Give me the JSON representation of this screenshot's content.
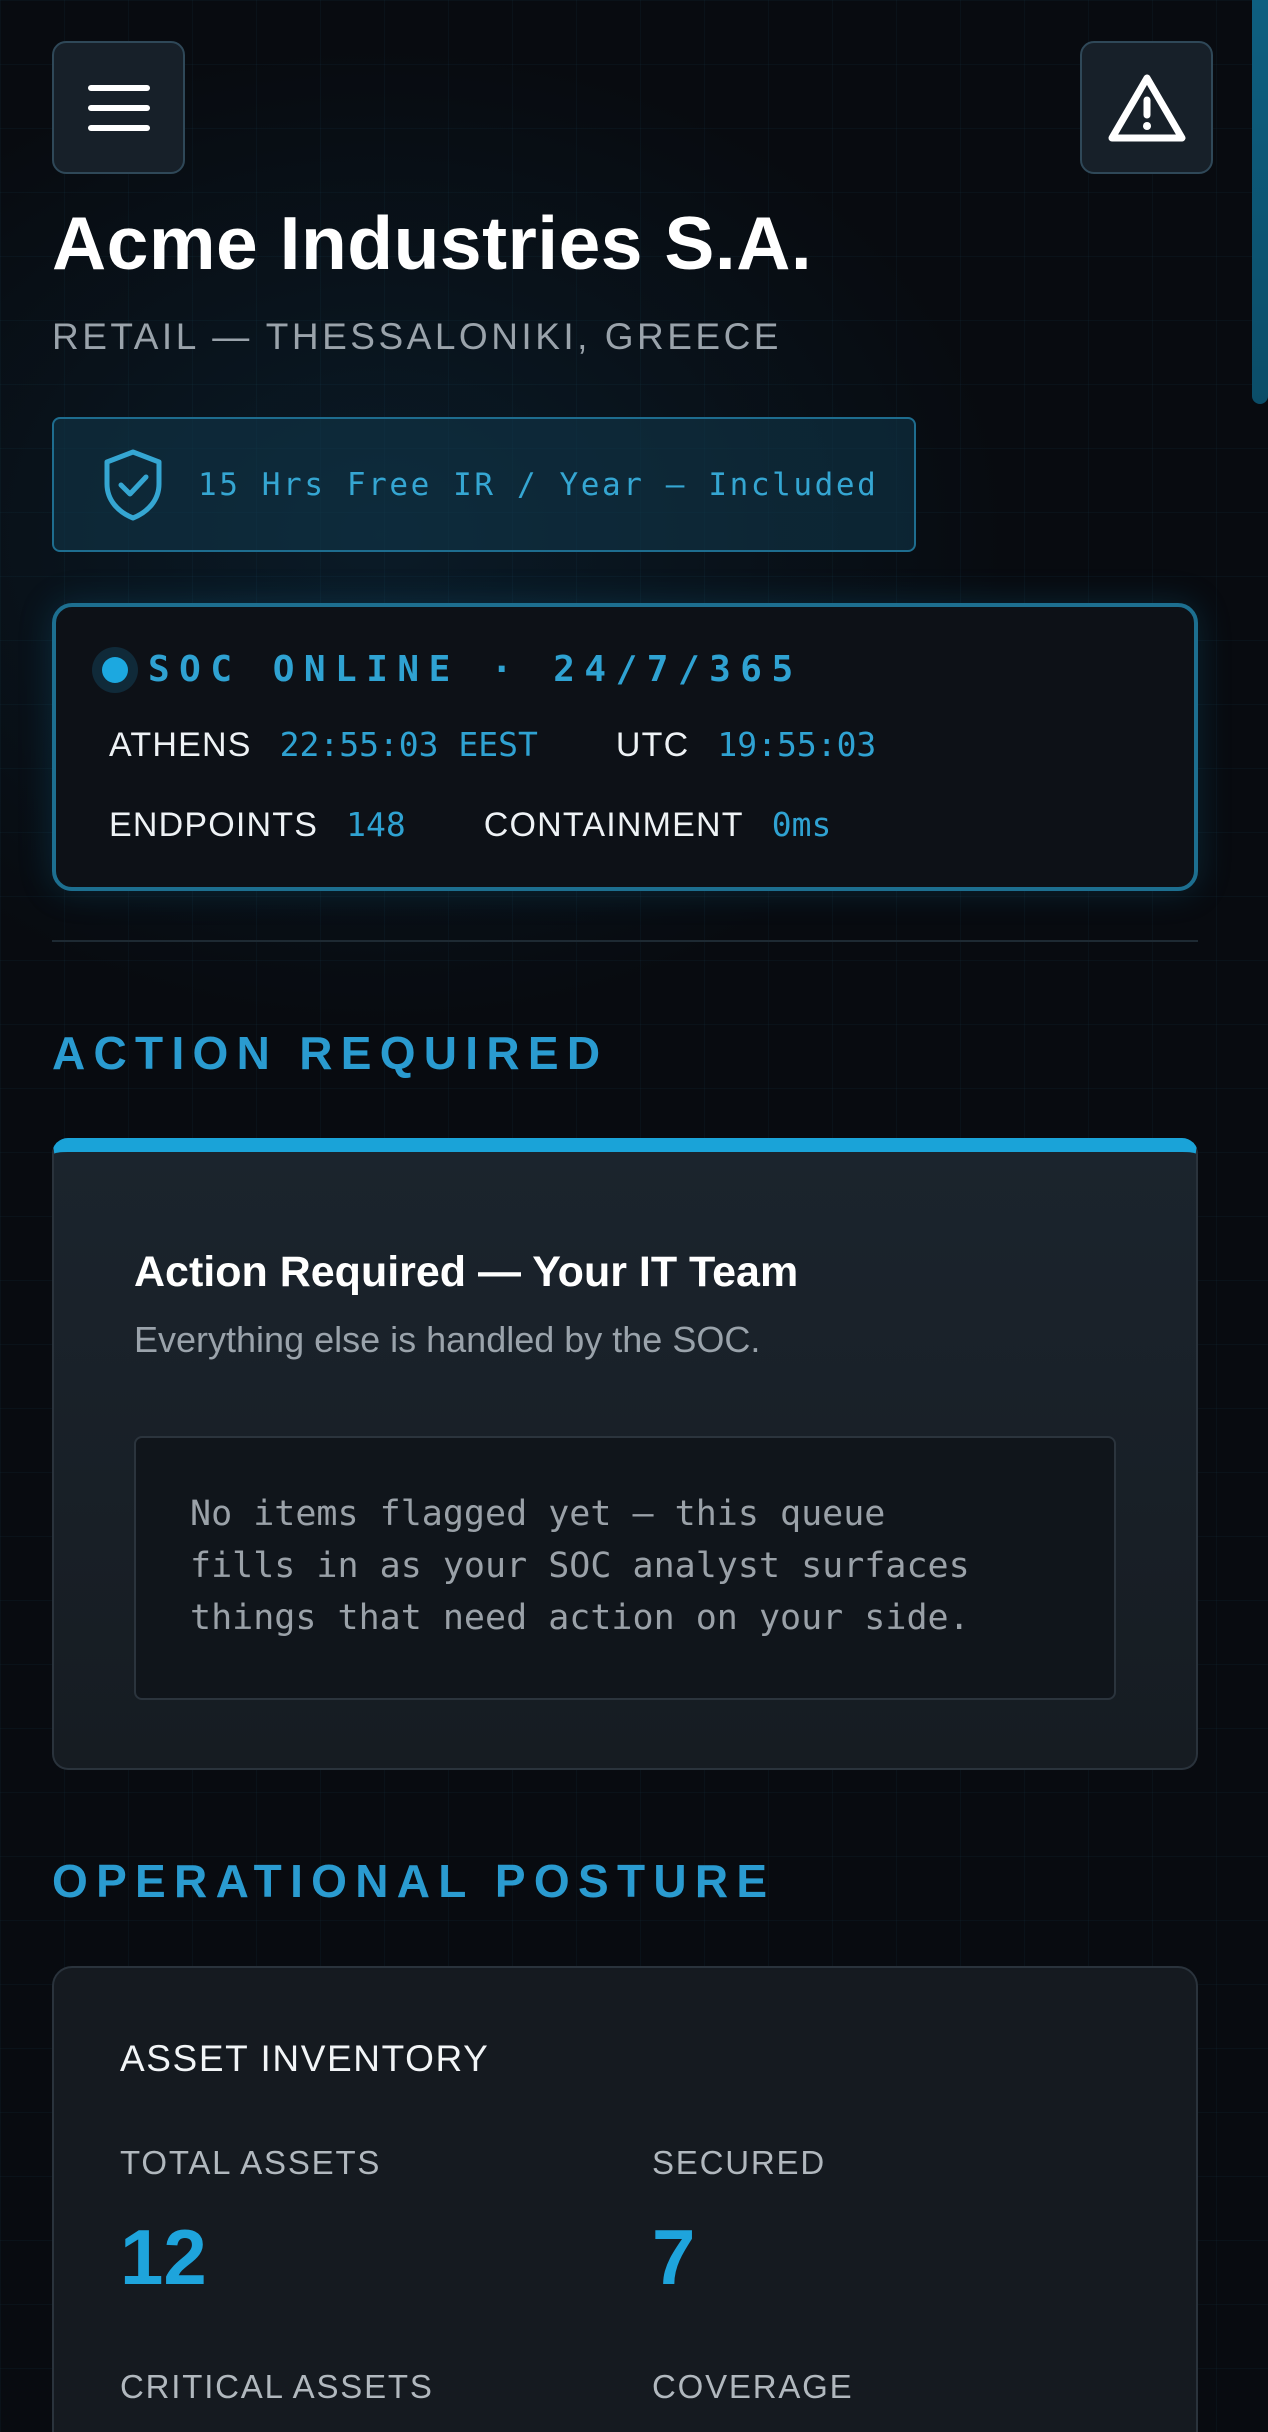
{
  "header": {
    "menu_icon": "hamburger-menu-icon",
    "alert_icon": "warning-triangle-icon"
  },
  "company": {
    "name": "Acme Industries S.A.",
    "subtitle": "RETAIL — THESSALONIKI, GREECE"
  },
  "ir_badge": {
    "icon": "shield-check-icon",
    "text": "15 Hrs Free IR / Year — Included"
  },
  "status": {
    "headline": "SOC ONLINE · 24/7/365",
    "athens_label": "ATHENS",
    "athens_time": "22:55:03 EEST",
    "utc_label": "UTC",
    "utc_time": "19:55:03",
    "endpoints_label": "ENDPOINTS",
    "endpoints_value": "148",
    "containment_label": "CONTAINMENT",
    "containment_value": "0ms"
  },
  "action_section": {
    "heading": "ACTION REQUIRED",
    "card_title": "Action Required — Your IT Team",
    "card_subtitle": "Everything else is handled by the SOC.",
    "queue_lines": [
      "No items flagged yet — this queue",
      "fills in as your SOC analyst surfaces",
      "things that need action on your side."
    ]
  },
  "posture_section": {
    "heading": "OPERATIONAL POSTURE",
    "card_title": "ASSET INVENTORY",
    "total_assets_label": "TOTAL ASSETS",
    "total_assets_value": "12",
    "secured_label": "SECURED",
    "secured_value": "7",
    "critical_assets_label": "CRITICAL ASSETS",
    "coverage_label": "COVERAGE"
  },
  "colors": {
    "accent": "#1ea4dc",
    "background": "#080b10",
    "panel": "#0d1117",
    "muted_text": "#9aa3ab"
  }
}
